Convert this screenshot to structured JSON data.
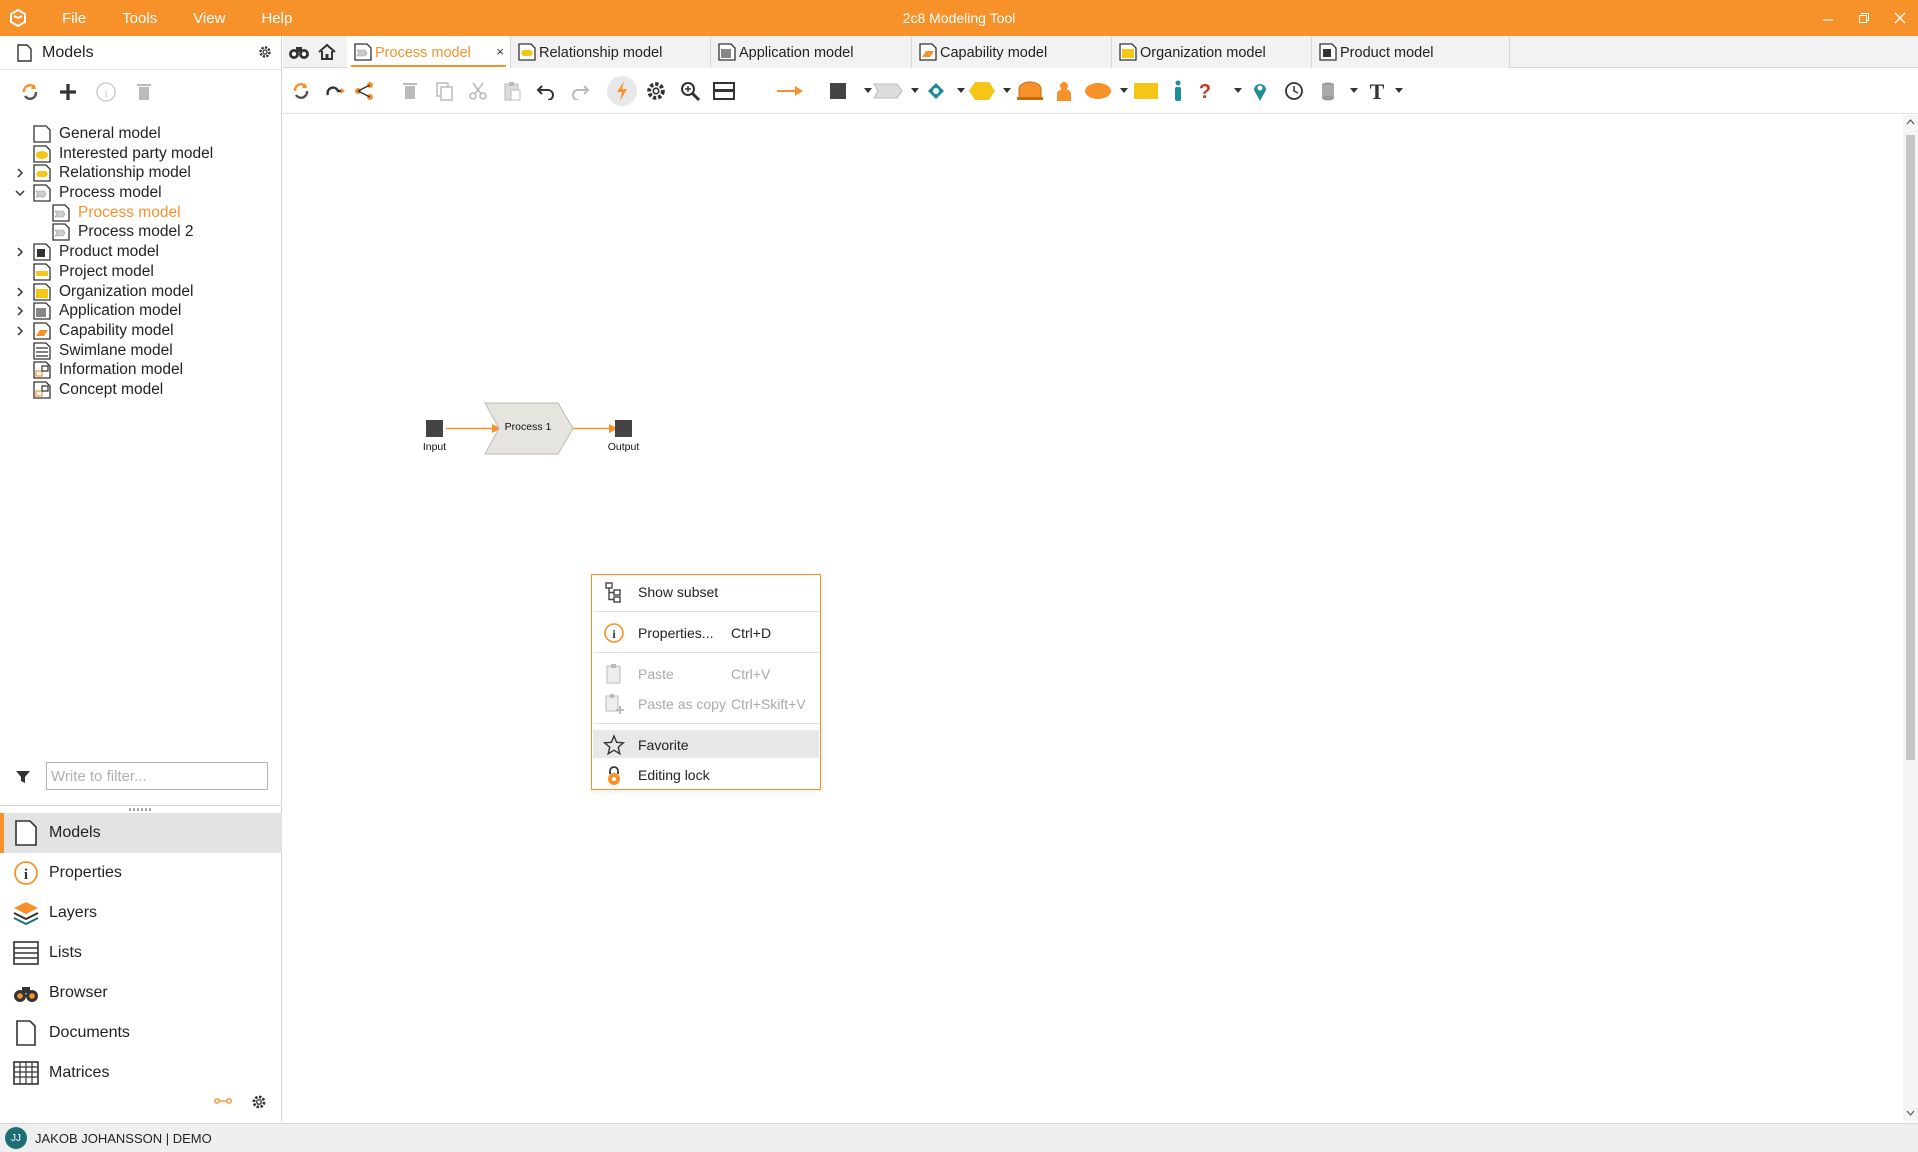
{
  "app": {
    "title": "2c8 Modeling Tool",
    "menu": [
      "File",
      "Tools",
      "View",
      "Help"
    ],
    "accent_color": "#f7922b"
  },
  "left_panel": {
    "header_title": "Models",
    "tree": [
      {
        "label": "General model",
        "icon": "general-model-icon",
        "expandable": false
      },
      {
        "label": "Interested party model",
        "icon": "interested-party-model-icon",
        "expandable": false
      },
      {
        "label": "Relationship model",
        "icon": "relationship-model-icon",
        "expandable": true,
        "expanded": false
      },
      {
        "label": "Process model",
        "icon": "process-model-icon",
        "expandable": true,
        "expanded": true
      },
      {
        "label": "Process model",
        "icon": "process-model-icon",
        "child": true,
        "selected": true
      },
      {
        "label": "Process model 2",
        "icon": "process-model-icon",
        "child": true
      },
      {
        "label": "Product model",
        "icon": "product-model-icon",
        "expandable": true,
        "expanded": false
      },
      {
        "label": "Project model",
        "icon": "project-model-icon",
        "expandable": false
      },
      {
        "label": "Organization model",
        "icon": "organization-model-icon",
        "expandable": true,
        "expanded": false
      },
      {
        "label": "Application model",
        "icon": "application-model-icon",
        "expandable": true,
        "expanded": false
      },
      {
        "label": "Capability model",
        "icon": "capability-model-icon",
        "expandable": true,
        "expanded": false
      },
      {
        "label": "Swimlane model",
        "icon": "swimlane-model-icon",
        "expandable": false
      },
      {
        "label": "Information model",
        "icon": "information-model-icon",
        "expandable": false
      },
      {
        "label": "Concept model",
        "icon": "concept-model-icon",
        "expandable": false
      }
    ],
    "filter_placeholder": "Write to filter...",
    "nav": [
      {
        "label": "Models",
        "icon": "models-icon",
        "active": true
      },
      {
        "label": "Properties",
        "icon": "properties-icon"
      },
      {
        "label": "Layers",
        "icon": "layers-icon"
      },
      {
        "label": "Lists",
        "icon": "lists-icon"
      },
      {
        "label": "Browser",
        "icon": "browser-icon"
      },
      {
        "label": "Documents",
        "icon": "documents-icon"
      },
      {
        "label": "Matrices",
        "icon": "matrices-icon"
      }
    ]
  },
  "tabs": [
    {
      "label": "Process model",
      "active": true,
      "closable": true
    },
    {
      "label": "Relationship model"
    },
    {
      "label": "Application model"
    },
    {
      "label": "Capability model"
    },
    {
      "label": "Organization model"
    },
    {
      "label": "Product model"
    }
  ],
  "diagram": {
    "nodes": [
      {
        "label": "Input",
        "type": "input"
      },
      {
        "label": "Process 1",
        "type": "process"
      },
      {
        "label": "Output",
        "type": "output"
      }
    ]
  },
  "context_menu": {
    "items": [
      {
        "label": "Show subset",
        "shortcut": "",
        "icon": "show-subset-icon",
        "disabled": false
      },
      {
        "label": "Properties...",
        "shortcut": "Ctrl+D",
        "icon": "properties-icon",
        "disabled": false
      },
      {
        "label": "Paste",
        "shortcut": "Ctrl+V",
        "icon": "paste-icon",
        "disabled": true
      },
      {
        "label": "Paste as copy",
        "shortcut": "Ctrl+Skift+V",
        "icon": "paste-as-copy-icon",
        "disabled": true
      },
      {
        "label": "Favorite",
        "shortcut": "",
        "icon": "star-icon",
        "disabled": false,
        "hovered": true
      },
      {
        "label": "Editing lock",
        "shortcut": "",
        "icon": "lock-icon",
        "disabled": false
      }
    ]
  },
  "status": {
    "initials": "JJ",
    "user": "JAKOB JOHANSSON | DEMO"
  }
}
